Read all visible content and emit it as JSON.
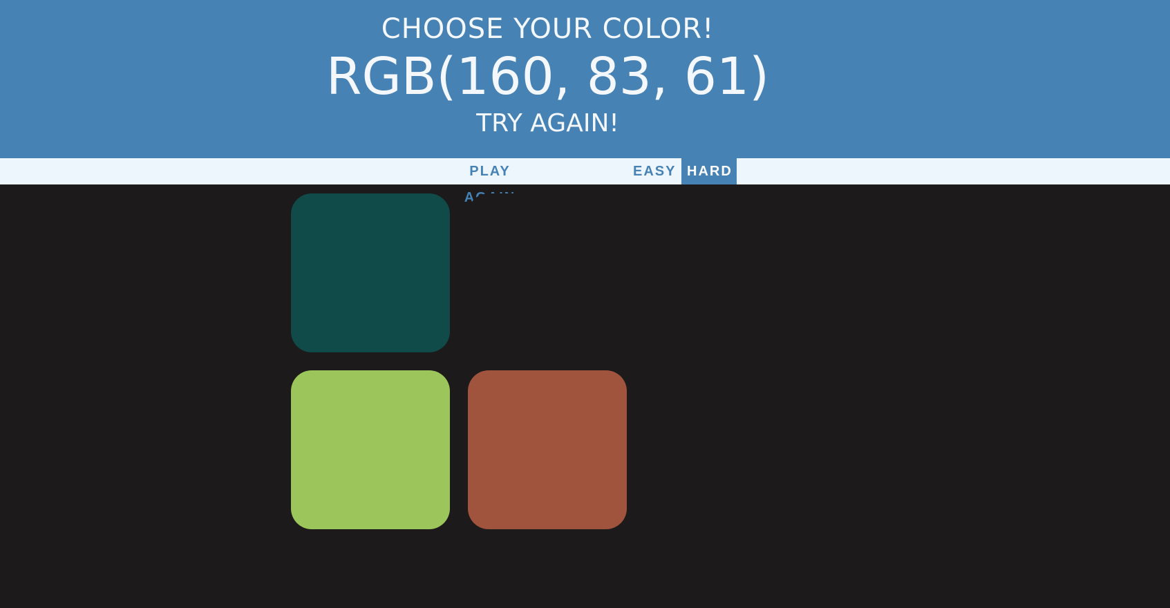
{
  "header": {
    "title": "CHOOSE YOUR COLOR!",
    "rgb_display": "RGB(160, 83, 61)",
    "message": "TRY AGAIN!"
  },
  "controls": {
    "play_again_label": "PLAY AGAIN",
    "easy_label": "EASY",
    "hard_label": "HARD",
    "selected_mode": "HARD"
  },
  "squares": [
    {
      "color": "#104b4a",
      "visible": true
    },
    {
      "color": "#1c1a1b",
      "visible": false
    },
    {
      "color": "#1c1a1b",
      "visible": false
    },
    {
      "color": "#9cc65c",
      "visible": true
    },
    {
      "color": "#a0533d",
      "visible": true
    },
    {
      "color": "#1c1a1b",
      "visible": false
    }
  ],
  "colors": {
    "header_bg": "#4682b4",
    "stripe_bg": "#eef6fd",
    "board_bg": "#1c1a1b",
    "accent": "#4682b4"
  }
}
